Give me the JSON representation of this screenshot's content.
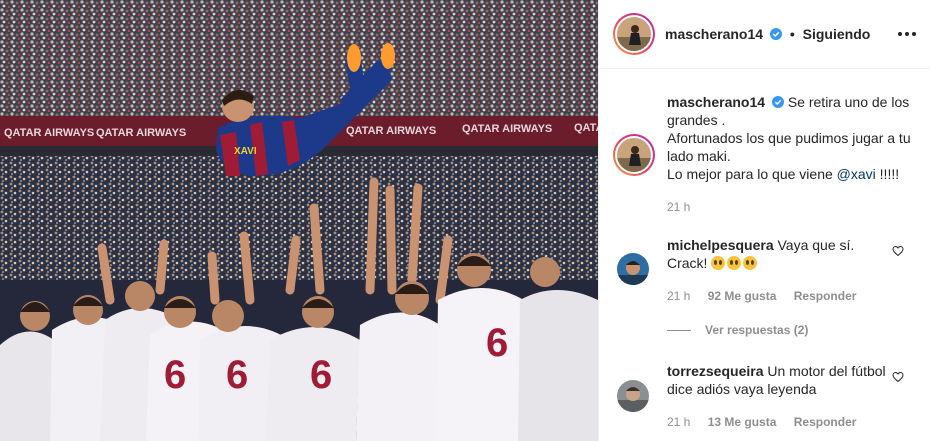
{
  "photo": {
    "ad_board": [
      "QATAR AIRWAYS",
      "QATAR AIRWAYS",
      "QATAR AIRWAYS",
      "QATAR AIRWAYS",
      "QATAR AIRWAYS"
    ],
    "jersey_name": "XAVI",
    "shirt_numbers": [
      "6",
      "6",
      "6",
      "6"
    ]
  },
  "header": {
    "username": "mascherano14",
    "separator": "•",
    "follow_label": "Siguiendo",
    "verified_icon": "verified-badge-icon",
    "more_icon": "more-options-icon"
  },
  "caption": {
    "username": "mascherano14",
    "line1": "Se retira uno de los grandes .",
    "line2": "Afortunados los que pudimos jugar a tu lado maki.",
    "line3_prefix": "Lo mejor para lo que viene ",
    "mention": "@xavi",
    "line3_suffix": " !!!!!",
    "time": "21 h"
  },
  "comments": [
    {
      "username": "michelpesquera",
      "text": "Vaya que sí. Crack!",
      "time": "21 h",
      "likes": "92 Me gusta",
      "reply": "Responder",
      "view_replies": "Ver respuestas (2)"
    },
    {
      "username": "torrezsequeira",
      "text": "Un motor del fútbol dice adiós vaya leyenda",
      "time": "21 h",
      "likes": "13 Me gusta",
      "reply": "Responder"
    }
  ],
  "colors": {
    "verified": "#3897f0",
    "mention": "#00376b",
    "muted": "#8e8e8e",
    "ring_start": "#f9a23c",
    "ring_end": "#b52ba7"
  }
}
